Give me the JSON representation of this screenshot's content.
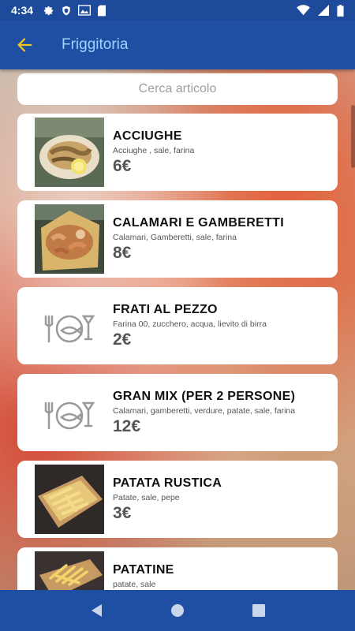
{
  "status_bar": {
    "time": "4:34",
    "icons_left": [
      "gear-icon",
      "shield-icon",
      "gallery-icon",
      "sd-card-icon"
    ],
    "icons_right": [
      "wifi-icon",
      "signal-icon",
      "battery-icon"
    ]
  },
  "app_bar": {
    "title": "Friggitoria",
    "back_icon": "arrow-left-icon",
    "accent_color": "#f5c518",
    "title_color": "#9fd3ff",
    "background_color": "#1f4fa3"
  },
  "search": {
    "placeholder": "Cerca articolo",
    "value": ""
  },
  "items": [
    {
      "name": "ACCIUGHE",
      "ingredients": "Acciughe , sale, farina",
      "price": "6€",
      "image": "photo-anchovies"
    },
    {
      "name": "CALAMARI E GAMBERETTI",
      "ingredients": "Calamari, Gamberetti, sale, farina",
      "price": "8€",
      "image": "photo-squid-shrimp"
    },
    {
      "name": "FRATI AL PEZZO",
      "ingredients": "Farina 00, zucchero, acqua, lievito di birra",
      "price": "2€",
      "image": "placeholder-food-icon"
    },
    {
      "name": "GRAN MIX (PER 2 PERSONE)",
      "ingredients": "Calamari, gamberetti, verdure, patate, sale, farina",
      "price": "12€",
      "image": "placeholder-food-icon"
    },
    {
      "name": "PATATA RUSTICA",
      "ingredients": "Patate, sale, pepe",
      "price": "3€",
      "image": "photo-rustic-fries"
    },
    {
      "name": "PATATINE",
      "ingredients": "patate, sale",
      "price": "",
      "image": "photo-fries"
    }
  ],
  "nav_bar": {
    "buttons": [
      "back-triangle-icon",
      "home-circle-icon",
      "recents-square-icon"
    ]
  }
}
